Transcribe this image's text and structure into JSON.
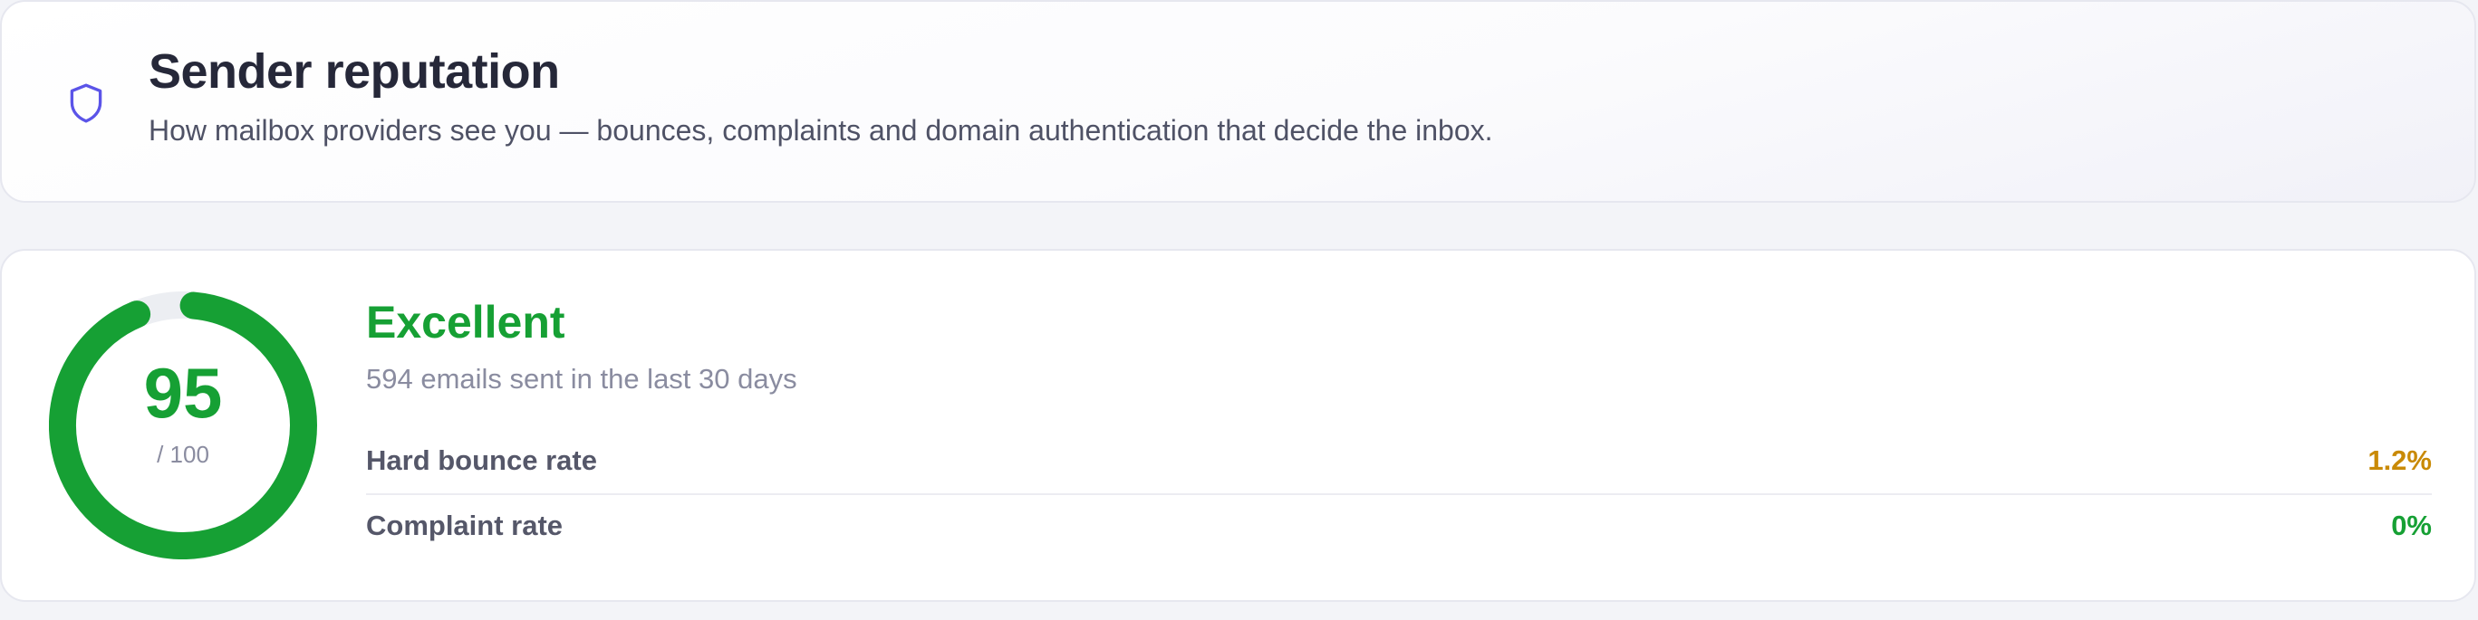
{
  "header": {
    "icon": "shield-icon",
    "title": "Sender reputation",
    "subtitle": "How mailbox providers see you — bounces, complaints and domain authentication that decide the inbox."
  },
  "score": {
    "value": "95",
    "max_label": "/ 100",
    "fraction": 0.95,
    "color": "#16a034",
    "status": "Excellent",
    "emails_sent": "594 emails sent in the last 30 days"
  },
  "metrics": [
    {
      "label": "Hard bounce rate",
      "value": "1.2%",
      "color": "#c98a06"
    },
    {
      "label": "Complaint rate",
      "value": "0%",
      "color": "#16a034"
    }
  ],
  "colors": {
    "accent_icon": "#5b54e8",
    "good": "#16a034",
    "warning": "#c98a06"
  }
}
